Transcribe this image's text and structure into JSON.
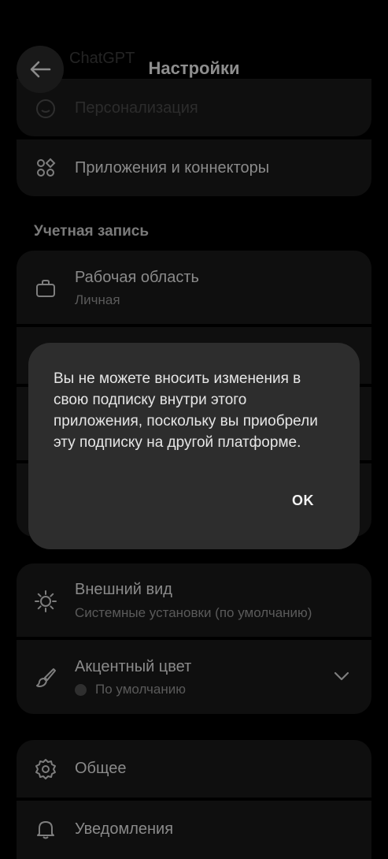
{
  "header": {
    "faded_title": "ChatGPT",
    "title": "Настройки"
  },
  "rows": {
    "personalization": {
      "label": "Персонализация",
      "icon": "smile-icon"
    },
    "apps": {
      "label": "Приложения и коннекторы",
      "icon": "apps-grid-icon"
    }
  },
  "account_section": {
    "header": "Учетная запись",
    "workspace": {
      "label": "Рабочая область",
      "value": "Личная",
      "icon": "briefcase-icon"
    }
  },
  "appearance": {
    "label": "Внешний вид",
    "value": "Системные установки (по умолчанию)",
    "icon": "sun-icon"
  },
  "accent": {
    "label": "Акцентный цвет",
    "value": "По умолчанию",
    "icon": "paintbrush-icon",
    "swatch_color": "#2f2f2f"
  },
  "general": {
    "label": "Общее",
    "icon": "gear-icon"
  },
  "notifications": {
    "label": "Уведомления",
    "icon": "bell-icon"
  },
  "dialog": {
    "message": "Вы не можете вносить изменения в свою подписку внутри этого приложения, поскольку вы приобрели эту подписку на другой платформе.",
    "ok_label": "OK"
  },
  "colors": {
    "background": "#000000",
    "card": "#0f0f0f",
    "dialog": "#2d2d2d"
  }
}
